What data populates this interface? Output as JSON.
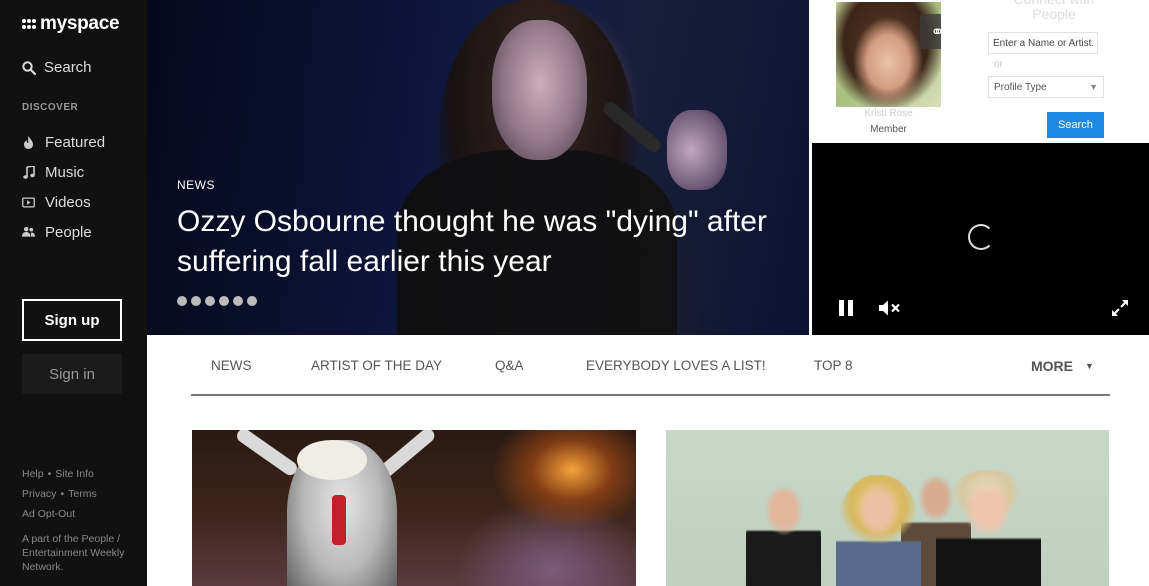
{
  "brand": {
    "logo_text": "myspace"
  },
  "sidebar": {
    "search_label": "Search",
    "discover_label": "DISCOVER",
    "items": [
      {
        "label": "Featured",
        "icon": "flame-icon"
      },
      {
        "label": "Music",
        "icon": "music-note-icon"
      },
      {
        "label": "Videos",
        "icon": "video-icon"
      },
      {
        "label": "People",
        "icon": "people-icon"
      }
    ],
    "signup_label": "Sign up",
    "signin_label": "Sign in",
    "footer": {
      "help": "Help",
      "site_info": "Site Info",
      "privacy": "Privacy",
      "terms": "Terms",
      "ad_opt_out": "Ad Opt-Out",
      "network": "A part of the People / Entertainment Weekly Network."
    }
  },
  "hero": {
    "category": "NEWS",
    "title": "Ozzy Osbourne thought he was \"dying\" after suffering fall earlier this year",
    "slide_count": 6
  },
  "connect": {
    "title": "Connect with People",
    "member_name": "Kristi Rose",
    "member_role": "Member",
    "name_placeholder": "Enter a Name or Artist...",
    "or_label": "or",
    "profile_type": "Profile Type",
    "search_label": "Search"
  },
  "tabs": {
    "items": [
      "NEWS",
      "ARTIST OF THE DAY",
      "Q&A",
      "EVERYBODY LOVES A LIST!",
      "TOP 8"
    ],
    "more_label": "MORE"
  },
  "colors": {
    "sidebar_bg": "#111111",
    "accent_blue": "#1e88e5",
    "video_bg": "#000000"
  }
}
